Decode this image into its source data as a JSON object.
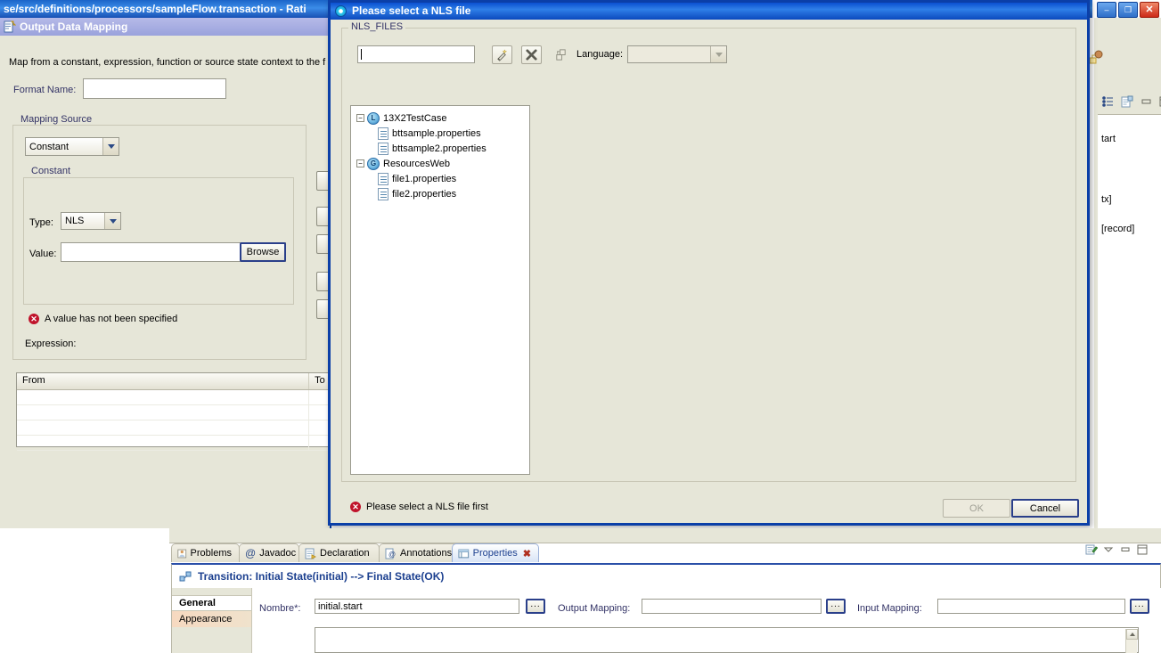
{
  "ide": {
    "title": "se/src/definitions/processors/sampleFlow.transaction - Rati",
    "window_buttons": [
      {
        "name": "minimize",
        "glyph": "–"
      },
      {
        "name": "restore",
        "glyph": "❐"
      },
      {
        "name": "close",
        "glyph": "✕"
      }
    ]
  },
  "editor": {
    "tab_label": "Output Data Mapping",
    "description": "Map from a constant, expression, function or source state context to the f",
    "format_name_label": "Format Name:",
    "format_name_value": "",
    "mapping_source": {
      "group_label": "Mapping Source",
      "source_combo_value": "Constant",
      "constant_group_label": "Constant",
      "type_label": "Type:",
      "type_value": "NLS",
      "value_label": "Value:",
      "value_text": "",
      "browse_label": "Browse"
    },
    "error_text": "A value has not been specified",
    "expression_label": "Expression:",
    "table": {
      "columns": [
        "From",
        "To"
      ],
      "rows": []
    }
  },
  "right_panel": {
    "texts": [
      "tart",
      "tx]",
      "[record]"
    ]
  },
  "dialog": {
    "title": "Please select a NLS file",
    "group_label": "NLS_FILES",
    "filter_value": "",
    "toolbar": [
      {
        "name": "new-nls-wand-icon",
        "tooltip": "New"
      },
      {
        "name": "delete-x-icon",
        "tooltip": "Delete"
      },
      {
        "name": "refresh-sync-icon",
        "tooltip": "Refresh"
      }
    ],
    "language_label": "Language:",
    "language_value": "",
    "tree": [
      {
        "label": "13X2TestCase",
        "type": "project",
        "badge": "L",
        "level": 0,
        "expanded": true
      },
      {
        "label": "bttsample.properties",
        "type": "file",
        "level": 1
      },
      {
        "label": "bttsample2.properties",
        "type": "file",
        "level": 1
      },
      {
        "label": "ResourcesWeb",
        "type": "project",
        "badge": "G",
        "level": 0,
        "expanded": true
      },
      {
        "label": "file1.properties",
        "type": "file",
        "level": 1
      },
      {
        "label": "file2.properties",
        "type": "file",
        "level": 1
      }
    ],
    "status_text": "Please select a NLS file first",
    "ok_label": "OK",
    "cancel_label": "Cancel"
  },
  "properties_view": {
    "tabs": [
      {
        "label": "Problems",
        "icon": "problems-icon",
        "active": false
      },
      {
        "label": "Javadoc",
        "icon": "javadoc-at-icon",
        "active": false
      },
      {
        "label": "Declaration",
        "icon": "declaration-icon",
        "active": false
      },
      {
        "label": "Annotations",
        "icon": "annotations-icon",
        "active": false
      },
      {
        "label": "Properties",
        "icon": "properties-icon",
        "active": true
      }
    ],
    "header_title": "Transition: Initial State(initial) --> Final State(OK)",
    "side_tabs": [
      {
        "label": "General",
        "active": true
      },
      {
        "label": "Appearance",
        "active": false
      }
    ],
    "form": {
      "nombre_label": "Nombre*:",
      "nombre_value": "initial.start",
      "output_mapping_label": "Output Mapping:",
      "output_mapping_value": "",
      "input_mapping_label": "Input Mapping:",
      "input_mapping_value": "",
      "ellipsis_label": "..."
    },
    "toolbar": [
      {
        "name": "new-property-icon"
      },
      {
        "name": "view-menu-icon"
      },
      {
        "name": "minimize-view-icon"
      },
      {
        "name": "maximize-view-icon"
      }
    ]
  },
  "colors": {
    "dialog_border": "#0b3fa8",
    "title_blue": "#0a4fd0",
    "eclipse_bg": "#e6e6d8",
    "error_red": "#c0132b",
    "link_blue": "#333366"
  }
}
